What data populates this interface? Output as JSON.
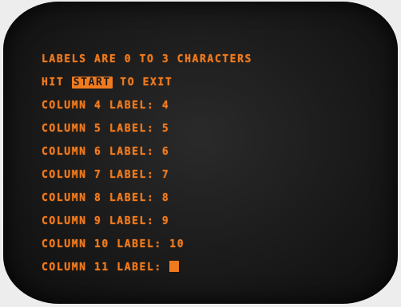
{
  "screen": {
    "accent_color": "#f07a1e",
    "header": "LABELS ARE 0 TO 3 CHARACTERS",
    "exit_prefix": "HIT ",
    "exit_key": "START",
    "exit_suffix": " TO EXIT",
    "rows": [
      {
        "prompt": "COLUMN 4 LABEL: ",
        "value": "4"
      },
      {
        "prompt": "COLUMN 5 LABEL: ",
        "value": "5"
      },
      {
        "prompt": "COLUMN 6 LABEL: ",
        "value": "6"
      },
      {
        "prompt": "COLUMN 7 LABEL: ",
        "value": "7"
      },
      {
        "prompt": "COLUMN 8 LABEL: ",
        "value": "8"
      },
      {
        "prompt": "COLUMN 9 LABEL: ",
        "value": "9"
      },
      {
        "prompt": "COLUMN 10 LABEL: ",
        "value": "10"
      }
    ],
    "active_prompt": "COLUMN 11 LABEL: "
  }
}
